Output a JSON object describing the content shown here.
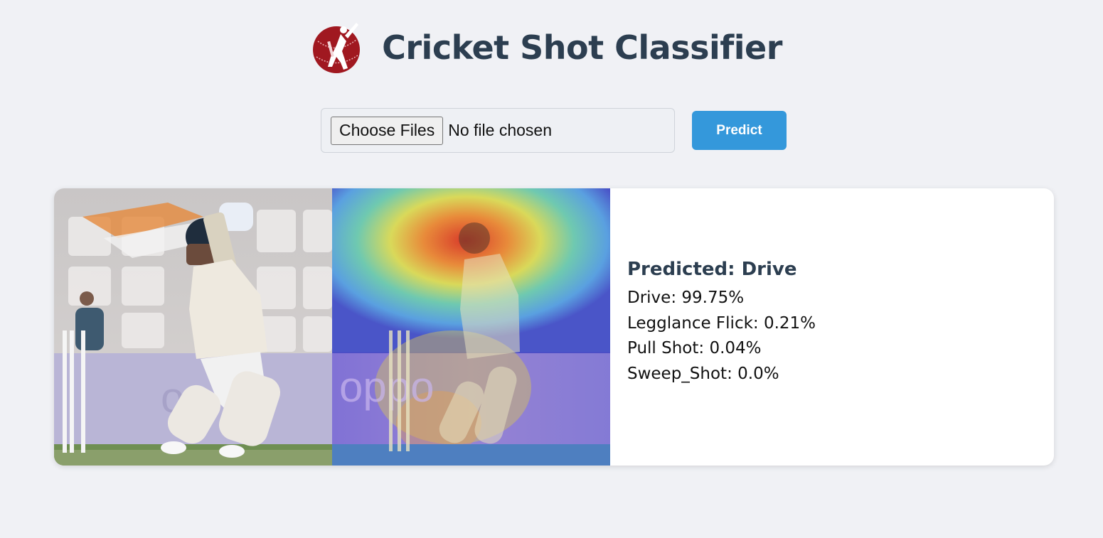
{
  "header": {
    "title": "Cricket Shot Classifier",
    "logo_icon": "cricket-batsman-logo-icon",
    "logo_color": "#a01820"
  },
  "upload": {
    "choose_label": "Choose Files",
    "status_text": "No file chosen",
    "predict_label": "Predict",
    "predict_color": "#3498db"
  },
  "result": {
    "predicted_title": "Predicted: Drive",
    "probabilities": [
      {
        "text": "Drive: 99.75%"
      },
      {
        "text": "Legglance Flick: 0.21%"
      },
      {
        "text": "Pull Shot: 0.04%"
      },
      {
        "text": "Sweep_Shot: 0.0%"
      }
    ]
  }
}
